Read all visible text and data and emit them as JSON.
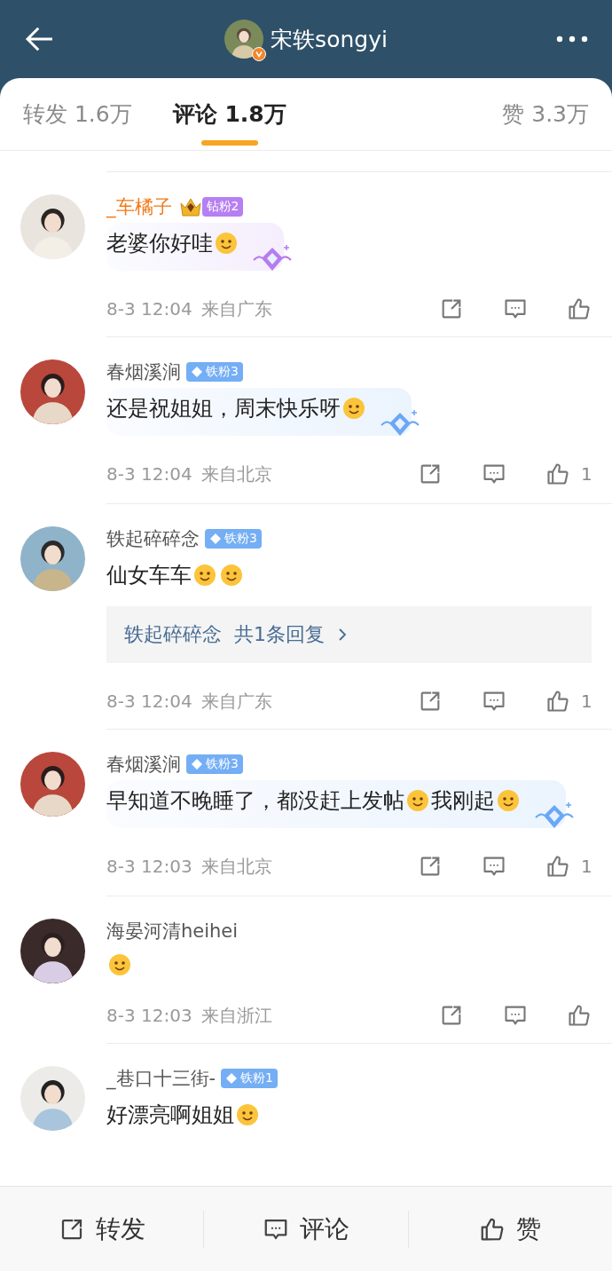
{
  "header": {
    "title": "宋轶songyi",
    "avatar": {
      "kind": "picture",
      "verified": true
    }
  },
  "tabs": [
    {
      "label": "转发 1.6万",
      "selected": false
    },
    {
      "label": "评论 1.8万",
      "selected": true
    },
    {
      "label": "赞 3.3万",
      "selected": false
    }
  ],
  "comments": [
    {
      "name": "_车橘子",
      "vip": true,
      "badge": {
        "kind": "diamond",
        "label": "钻粉2"
      },
      "bubble": {
        "color": "#b57cf0"
      },
      "parts": [
        {
          "kind": "text",
          "text": "老婆你好哇"
        },
        {
          "kind": "emoji"
        }
      ],
      "time": "8-3 12:04",
      "location": "来自广东"
    },
    {
      "name": "春烟溪涧",
      "vip": false,
      "badge": {
        "kind": "iron",
        "label": "铁粉3"
      },
      "bubble": {
        "color": "#6aa8f5"
      },
      "parts": [
        {
          "kind": "text",
          "text": "还是祝姐姐，周末快乐呀"
        },
        {
          "kind": "emoji"
        }
      ],
      "time": "8-3 12:04",
      "location": "来自北京",
      "likes": "1"
    },
    {
      "name": "轶起碎碎念",
      "vip": false,
      "badge": {
        "kind": "iron",
        "label": "铁粉3"
      },
      "parts": [
        {
          "kind": "text",
          "text": "仙女车车"
        },
        {
          "kind": "emoji"
        },
        {
          "kind": "emoji"
        }
      ],
      "replies": {
        "name": "轶起碎碎念",
        "summary": "共1条回复"
      },
      "time": "8-3 12:04",
      "location": "来自广东",
      "likes": "1"
    },
    {
      "name": "春烟溪涧",
      "vip": false,
      "badge": {
        "kind": "iron",
        "label": "铁粉3"
      },
      "bubble": {
        "color": "#6aa8f5"
      },
      "parts": [
        {
          "kind": "text",
          "text": "早知道不晚睡了，都没赶上发帖"
        },
        {
          "kind": "emoji"
        },
        {
          "kind": "text",
          "text": "我刚起"
        },
        {
          "kind": "emoji"
        }
      ],
      "time": "8-3 12:03",
      "location": "来自北京",
      "likes": "1"
    },
    {
      "name": "海晏河清heihei",
      "vip": false,
      "parts": [
        {
          "kind": "emoji"
        }
      ],
      "time": "8-3 12:03",
      "location": "来自浙江"
    },
    {
      "name": "_巷口十三街-",
      "vip": false,
      "badge": {
        "kind": "iron",
        "label": "铁粉1"
      },
      "parts": [
        {
          "kind": "text",
          "text": "好漂亮啊姐姐"
        },
        {
          "kind": "emoji"
        }
      ]
    }
  ],
  "footer": [
    {
      "kind": "share",
      "label": "转发"
    },
    {
      "kind": "comment",
      "label": "评论"
    },
    {
      "kind": "like",
      "label": "赞"
    }
  ]
}
